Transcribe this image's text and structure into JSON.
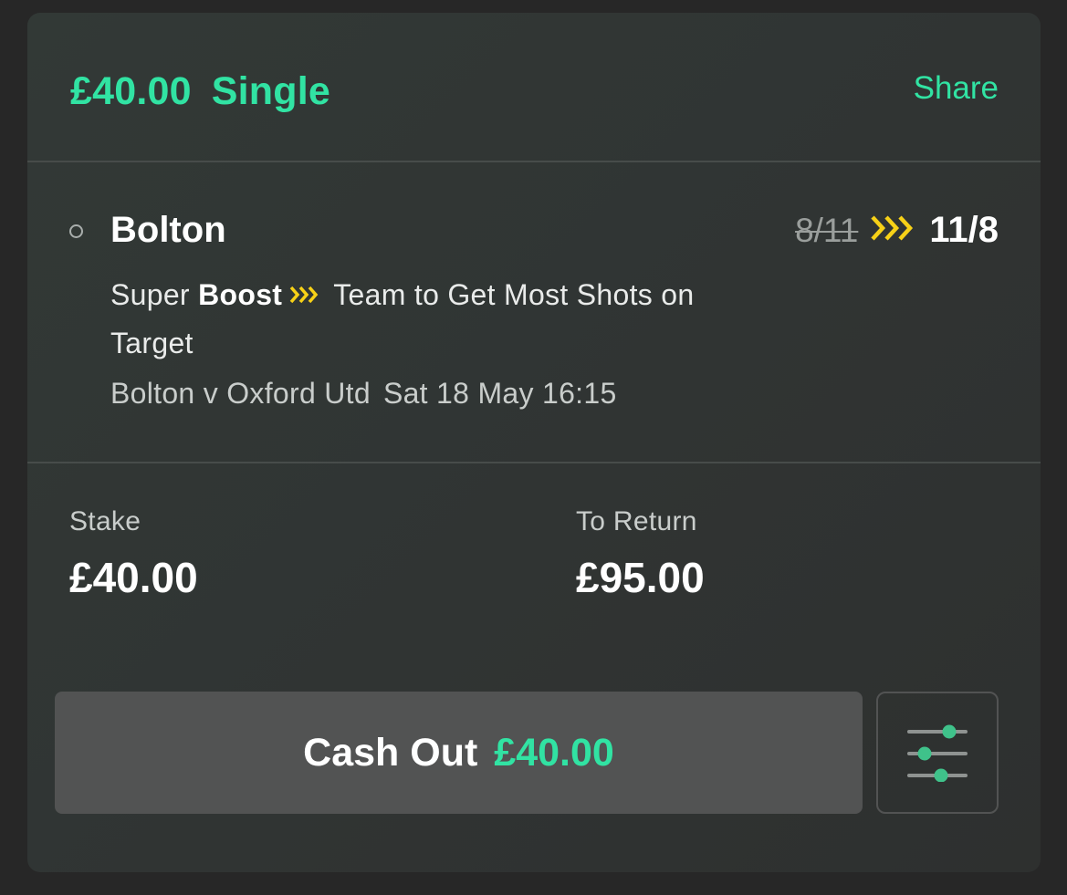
{
  "header": {
    "amount": "£40.00",
    "bet_type": "Single",
    "share_label": "Share"
  },
  "selection": {
    "name": "Bolton",
    "old_odds": "8/11",
    "new_odds": "11/8",
    "market_prefix": "Super",
    "market_boost": "Boost",
    "market_name": "Team to Get Most Shots on Target",
    "event_name": "Bolton v Oxford Utd",
    "event_time": "Sat 18 May 16:15"
  },
  "stake": {
    "label": "Stake",
    "value": "£40.00"
  },
  "to_return": {
    "label": "To Return",
    "value": "£95.00"
  },
  "cashout": {
    "label": "Cash Out",
    "amount": "£40.00"
  },
  "icons": {
    "boost": "boost-chevrons-icon",
    "settings": "sliders-icon",
    "selection_status": "radio-circle-icon"
  },
  "colors": {
    "accent_green": "#31e3a3",
    "boost_yellow": "#f7d117",
    "slider_green": "#3fc28a"
  }
}
